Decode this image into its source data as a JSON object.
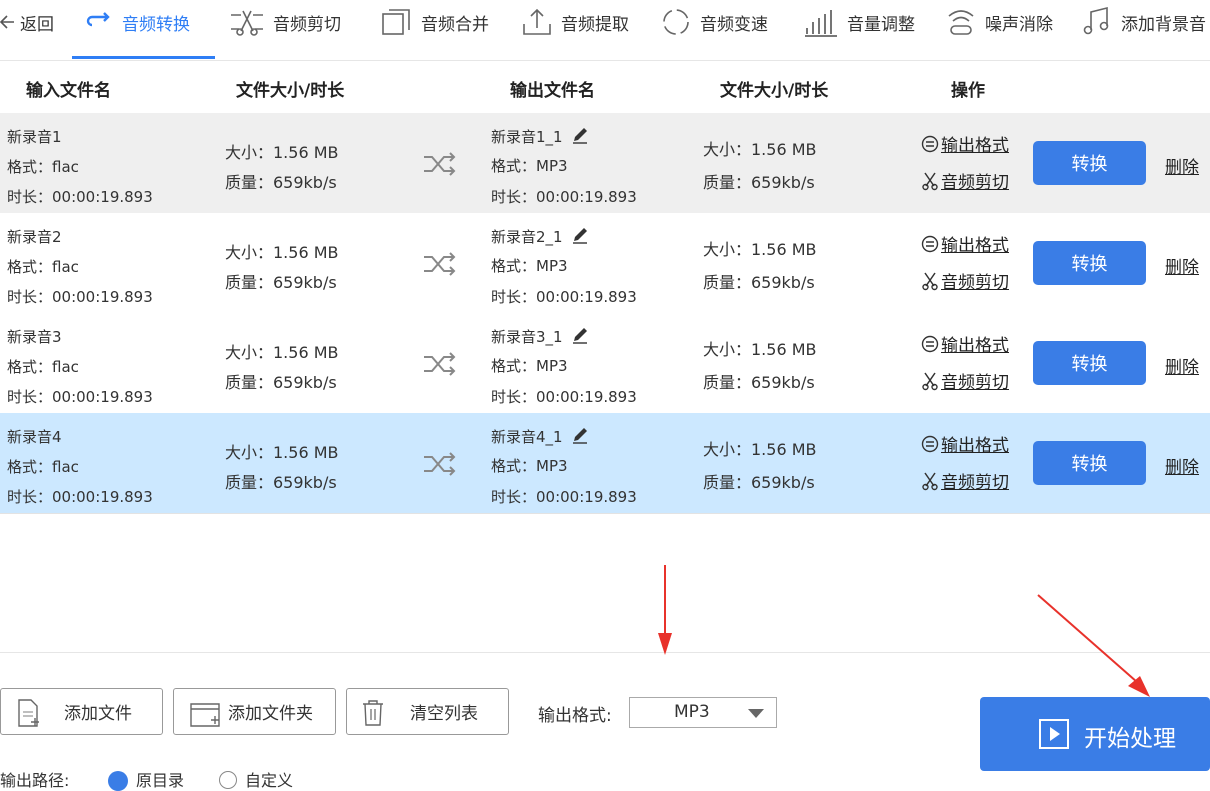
{
  "toolbar": {
    "back": "返回",
    "tabs": [
      "音频转换",
      "音频剪切",
      "音频合并",
      "音频提取",
      "音频变速",
      "音量调整",
      "噪声消除",
      "添加背景音"
    ]
  },
  "table": {
    "headers": [
      "输入文件名",
      "文件大小/时长",
      "输出文件名",
      "文件大小/时长",
      "操作"
    ],
    "rows": [
      {
        "in_name": "新录音1",
        "in_format": "格式：flac",
        "in_duration": "时长：00:00:19.893",
        "in_size": "大小：1.56 MB",
        "in_quality": "质量：659kb/s",
        "out_name": "新录音1_1",
        "out_format": "格式：MP3",
        "out_duration": "时长：00:00:19.893",
        "out_size": "大小：1.56 MB",
        "out_quality": "质量：659kb/s",
        "op_format": "输出格式",
        "op_cut": "音频剪切",
        "convert": "转换",
        "delete": "删除"
      },
      {
        "in_name": "新录音2",
        "in_format": "格式：flac",
        "in_duration": "时长：00:00:19.893",
        "in_size": "大小：1.56 MB",
        "in_quality": "质量：659kb/s",
        "out_name": "新录音2_1",
        "out_format": "格式：MP3",
        "out_duration": "时长：00:00:19.893",
        "out_size": "大小：1.56 MB",
        "out_quality": "质量：659kb/s",
        "op_format": "输出格式",
        "op_cut": "音频剪切",
        "convert": "转换",
        "delete": "删除"
      },
      {
        "in_name": "新录音3",
        "in_format": "格式：flac",
        "in_duration": "时长：00:00:19.893",
        "in_size": "大小：1.56 MB",
        "in_quality": "质量：659kb/s",
        "out_name": "新录音3_1",
        "out_format": "格式：MP3",
        "out_duration": "时长：00:00:19.893",
        "out_size": "大小：1.56 MB",
        "out_quality": "质量：659kb/s",
        "op_format": "输出格式",
        "op_cut": "音频剪切",
        "convert": "转换",
        "delete": "删除"
      },
      {
        "in_name": "新录音4",
        "in_format": "格式：flac",
        "in_duration": "时长：00:00:19.893",
        "in_size": "大小：1.56 MB",
        "in_quality": "质量：659kb/s",
        "out_name": "新录音4_1",
        "out_format": "格式：MP3",
        "out_duration": "时长：00:00:19.893",
        "out_size": "大小：1.56 MB",
        "out_quality": "质量：659kb/s",
        "op_format": "输出格式",
        "op_cut": "音频剪切",
        "convert": "转换",
        "delete": "删除"
      }
    ]
  },
  "bottom": {
    "add_file": "添加文件",
    "add_folder": "添加文件夹",
    "clear_list": "清空列表",
    "output_format_label": "输出格式:",
    "output_format_value": "MP3",
    "start": "开始处理",
    "output_path_label": "输出路径:",
    "radio_original": "原目录",
    "radio_custom": "自定义"
  },
  "colors": {
    "accent": "#3a7de6",
    "selected_row": "#cce8ff",
    "hover_row": "#efefef",
    "annotation_arrow": "#e8322b"
  }
}
